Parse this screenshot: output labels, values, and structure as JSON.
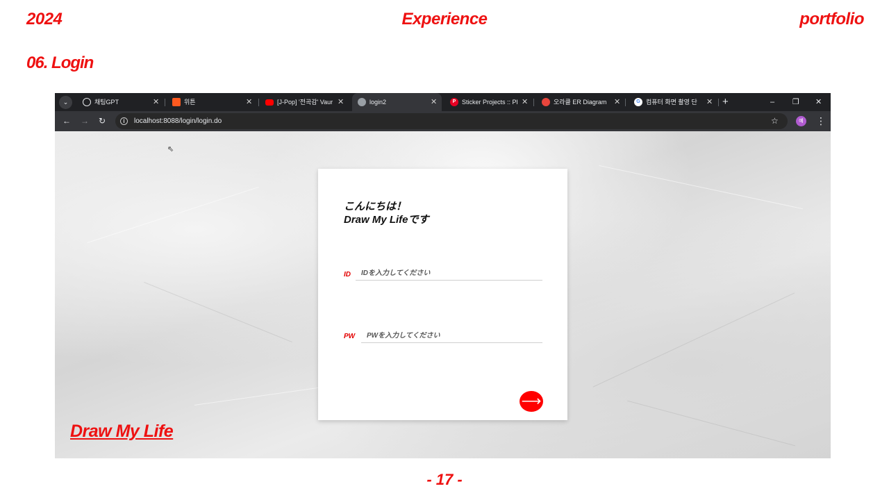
{
  "slide": {
    "year": "2024",
    "center": "Experience",
    "right": "portfolio",
    "section": "06. Login",
    "page": "- 17 -"
  },
  "browser": {
    "tab_menu_icon": "chevron-down-icon",
    "tabs": [
      {
        "title": "채팅GPT",
        "icon": "chatgpt-icon",
        "color": "#e8eaed",
        "active": false
      },
      {
        "title": "위튼",
        "icon": "app-icon",
        "color": "#ff5a1f",
        "active": false
      },
      {
        "title": "[J-Pop] '전곡감' Vaur",
        "icon": "youtube-icon",
        "color": "#ff0000",
        "active": false
      },
      {
        "title": "login2",
        "icon": "globe-icon",
        "color": "#9aa0a6",
        "active": true
      },
      {
        "title": "Sticker Projects :: Ph",
        "icon": "pinterest-icon",
        "color": "#e60023",
        "active": false
      },
      {
        "title": "오라클 ER Diagram",
        "icon": "site-icon",
        "color": "#e8453c",
        "active": false
      },
      {
        "title": "컴퓨터 화면 촬영 단",
        "icon": "google-icon",
        "color": "#4285f4",
        "active": false
      }
    ],
    "new_tab": "+",
    "window_controls": [
      "–",
      "❐",
      "✕"
    ],
    "url": "localhost:8088/login/login.do",
    "profile_initial": "예"
  },
  "login": {
    "greeting_line1": "こんにちは！",
    "greeting_line2": "Draw My Lifeです",
    "id_label": "ID",
    "id_placeholder": "IDを入力してください",
    "pw_label": "PW",
    "pw_placeholder": "PWを入力してください",
    "submit_icon": "arrow-right-icon",
    "submit_glyph": "⟶"
  },
  "logo": "Draw My Life",
  "colors": {
    "accent": "#ee1111",
    "submit": "#ff0000",
    "chrome_dark": "#202124",
    "chrome_toolbar": "#35363a"
  }
}
